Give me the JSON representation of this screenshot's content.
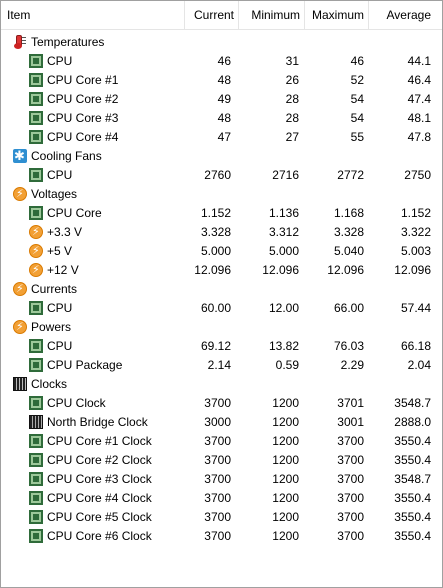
{
  "header": {
    "item": "Item",
    "current": "Current",
    "minimum": "Minimum",
    "maximum": "Maximum",
    "average": "Average"
  },
  "groups": {
    "temperatures": "Temperatures",
    "cooling_fans": "Cooling Fans",
    "voltages": "Voltages",
    "currents": "Currents",
    "powers": "Powers",
    "clocks": "Clocks"
  },
  "temperatures": [
    {
      "name": "CPU",
      "current": "46",
      "minimum": "31",
      "maximum": "46",
      "average": "44.1"
    },
    {
      "name": "CPU Core #1",
      "current": "48",
      "minimum": "26",
      "maximum": "52",
      "average": "46.4"
    },
    {
      "name": "CPU Core #2",
      "current": "49",
      "minimum": "28",
      "maximum": "54",
      "average": "47.4"
    },
    {
      "name": "CPU Core #3",
      "current": "48",
      "minimum": "28",
      "maximum": "54",
      "average": "48.1"
    },
    {
      "name": "CPU Core #4",
      "current": "47",
      "minimum": "27",
      "maximum": "55",
      "average": "47.8"
    }
  ],
  "cooling_fans": [
    {
      "name": "CPU",
      "current": "2760",
      "minimum": "2716",
      "maximum": "2772",
      "average": "2750"
    }
  ],
  "voltages": [
    {
      "name": "CPU Core",
      "current": "1.152",
      "minimum": "1.136",
      "maximum": "1.168",
      "average": "1.152"
    },
    {
      "name": "+3.3 V",
      "current": "3.328",
      "minimum": "3.312",
      "maximum": "3.328",
      "average": "3.322"
    },
    {
      "name": "+5 V",
      "current": "5.000",
      "minimum": "5.000",
      "maximum": "5.040",
      "average": "5.003"
    },
    {
      "name": "+12 V",
      "current": "12.096",
      "minimum": "12.096",
      "maximum": "12.096",
      "average": "12.096"
    }
  ],
  "currents": [
    {
      "name": "CPU",
      "current": "60.00",
      "minimum": "12.00",
      "maximum": "66.00",
      "average": "57.44"
    }
  ],
  "powers": [
    {
      "name": "CPU",
      "current": "69.12",
      "minimum": "13.82",
      "maximum": "76.03",
      "average": "66.18"
    },
    {
      "name": "CPU Package",
      "current": "2.14",
      "minimum": "0.59",
      "maximum": "2.29",
      "average": "2.04"
    }
  ],
  "clocks": [
    {
      "name": "CPU Clock",
      "current": "3700",
      "minimum": "1200",
      "maximum": "3701",
      "average": "3548.7"
    },
    {
      "name": "North Bridge Clock",
      "current": "3000",
      "minimum": "1200",
      "maximum": "3001",
      "average": "2888.0"
    },
    {
      "name": "CPU Core #1 Clock",
      "current": "3700",
      "minimum": "1200",
      "maximum": "3700",
      "average": "3550.4"
    },
    {
      "name": "CPU Core #2 Clock",
      "current": "3700",
      "minimum": "1200",
      "maximum": "3700",
      "average": "3550.4"
    },
    {
      "name": "CPU Core #3 Clock",
      "current": "3700",
      "minimum": "1200",
      "maximum": "3700",
      "average": "3548.7"
    },
    {
      "name": "CPU Core #4 Clock",
      "current": "3700",
      "minimum": "1200",
      "maximum": "3700",
      "average": "3550.4"
    },
    {
      "name": "CPU Core #5 Clock",
      "current": "3700",
      "minimum": "1200",
      "maximum": "3700",
      "average": "3550.4"
    },
    {
      "name": "CPU Core #6 Clock",
      "current": "3700",
      "minimum": "1200",
      "maximum": "3700",
      "average": "3550.4"
    }
  ]
}
